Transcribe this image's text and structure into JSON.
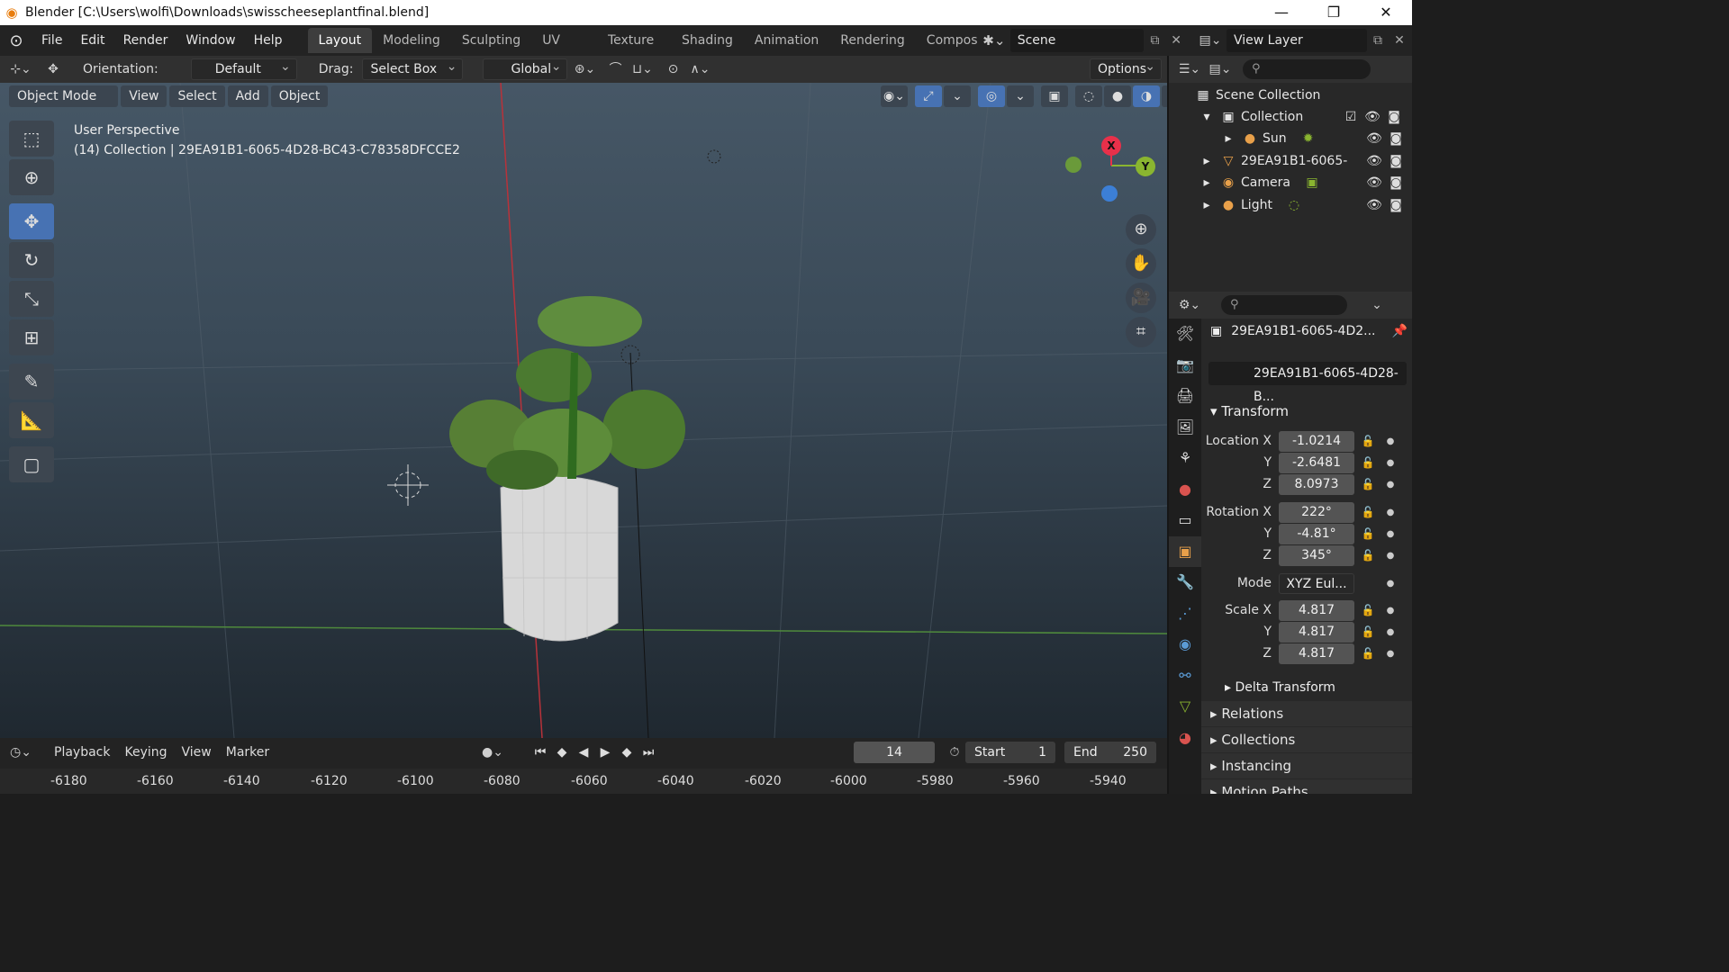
{
  "window": {
    "title": "Blender [C:\\Users\\wolfi\\Downloads\\swisscheeseplantfinal.blend]",
    "controls": [
      "—",
      "❐",
      "✕"
    ]
  },
  "menu": [
    "File",
    "Edit",
    "Render",
    "Window",
    "Help"
  ],
  "workspaces": [
    "Layout",
    "Modeling",
    "Sculpting",
    "UV Editing",
    "Texture Paint",
    "Shading",
    "Animation",
    "Rendering",
    "Compos"
  ],
  "active_workspace": "Layout",
  "scene": "Scene",
  "view_layer": "View Layer",
  "tool_header": {
    "orientation_label": "Orientation:",
    "orientation_value": "Default",
    "drag_label": "Drag:",
    "drag_value": "Select Box",
    "transform_orientation": "Global",
    "options": "Options"
  },
  "viewport": {
    "mode": "Object Mode",
    "menus": [
      "View",
      "Select",
      "Add",
      "Object"
    ],
    "perspective": "User Perspective",
    "collection_info": "(14) Collection | 29EA91B1-6065-4D28-BC43-C78358DFCCE2",
    "gizmo_axes": [
      "X",
      "Y",
      "Z"
    ]
  },
  "outliner": {
    "root": "Scene Collection",
    "collection": "Collection",
    "items": [
      "Sun",
      "29EA91B1-6065-",
      "Camera",
      "Light"
    ]
  },
  "properties": {
    "object_name_short": "29EA91B1-6065-4D2...",
    "object_name_field": "29EA91B1-6065-4D28-B...",
    "transform_header": "Transform",
    "location_label": "Location X",
    "rotation_label": "Rotation X",
    "scale_label": "Scale X",
    "y_label": "Y",
    "z_label": "Z",
    "mode_label": "Mode",
    "location": [
      "-1.0214",
      "-2.6481",
      "8.0973"
    ],
    "rotation": [
      "222°",
      "-4.81°",
      "345°"
    ],
    "mode": "XYZ Eul...",
    "scale": [
      "4.817",
      "4.817",
      "4.817"
    ],
    "delta": "Delta Transform",
    "sections": [
      "Relations",
      "Collections",
      "Instancing",
      "Motion Paths"
    ]
  },
  "timeline": {
    "menus": [
      "Playback",
      "Keying",
      "View",
      "Marker"
    ],
    "current_frame": "14",
    "start_label": "Start",
    "start": "1",
    "end_label": "End",
    "end": "250",
    "ruler": [
      "-6180",
      "-6160",
      "-6140",
      "-6120",
      "-6100",
      "-6080",
      "-6060",
      "-6040",
      "-6020",
      "-6000",
      "-5980",
      "-5960",
      "-5940"
    ]
  },
  "colors": {
    "accent": "#4772b3",
    "x_axis": "#e8304a",
    "y_axis": "#8ab530",
    "z_axis": "#3c7fd6"
  }
}
